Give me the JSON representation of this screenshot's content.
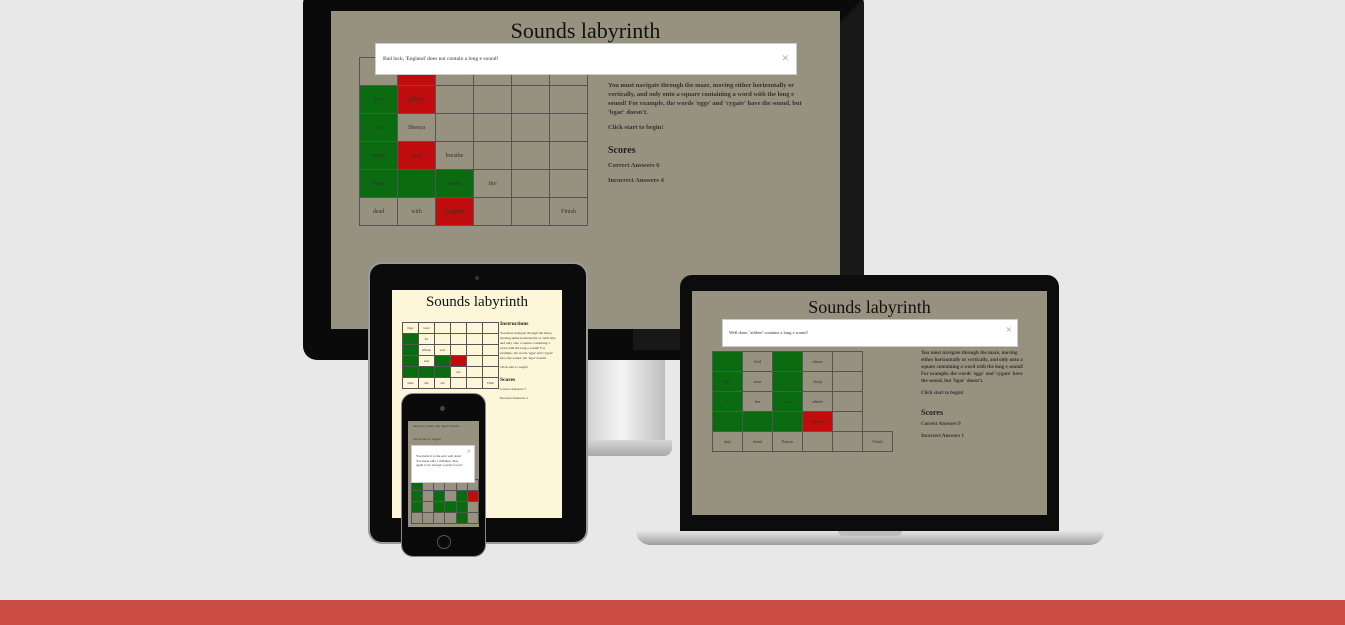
{
  "game_title": "Sounds labyrinth",
  "desktop": {
    "alert": "Bad luck, 'England' does not contain a long e sound!",
    "instructions": "You must navigate through the maze, moving either horizontally or vertically, and only onto a square containing a word with the long e sound! For example, the words 'eggs' and 'cygate' have the sound, but 'bgar' doesn't.",
    "start": "Click start to begin!",
    "scores_heading": "Scores",
    "correct": "Correct Answers 6",
    "incorrect": "Incorrect Answers 4",
    "maze": [
      [
        {
          "t": "",
          "c": ""
        },
        {
          "t": "",
          "c": "r"
        },
        {
          "t": "",
          "c": ""
        },
        {
          "t": "",
          "c": ""
        },
        {
          "t": "",
          "c": ""
        },
        {
          "t": "",
          "c": ""
        }
      ],
      [
        {
          "t": "key",
          "c": "g"
        },
        {
          "t": "pillow",
          "c": "r"
        },
        {
          "t": "",
          "c": ""
        },
        {
          "t": "",
          "c": ""
        },
        {
          "t": "",
          "c": ""
        },
        {
          "t": "",
          "c": ""
        }
      ],
      [
        {
          "t": "ice",
          "c": "g"
        },
        {
          "t": "Sheeza",
          "c": ""
        },
        {
          "t": "",
          "c": ""
        },
        {
          "t": "",
          "c": ""
        },
        {
          "t": "",
          "c": ""
        },
        {
          "t": "",
          "c": ""
        }
      ],
      [
        {
          "t": "sweep",
          "c": "g"
        },
        {
          "t": "steal",
          "c": "r"
        },
        {
          "t": "breathe",
          "c": ""
        },
        {
          "t": "",
          "c": ""
        },
        {
          "t": "",
          "c": ""
        },
        {
          "t": "",
          "c": ""
        }
      ],
      [
        {
          "t": "sheep",
          "c": "g"
        },
        {
          "t": "",
          "c": "g"
        },
        {
          "t": "seeds",
          "c": "g"
        },
        {
          "t": "fire",
          "c": ""
        },
        {
          "t": "",
          "c": ""
        },
        {
          "t": "",
          "c": ""
        }
      ],
      [
        {
          "t": "dead",
          "c": ""
        },
        {
          "t": "with",
          "c": ""
        },
        {
          "t": "England",
          "c": "r"
        },
        {
          "t": "",
          "c": ""
        },
        {
          "t": "",
          "c": ""
        },
        {
          "t": "Finish",
          "c": ""
        }
      ]
    ]
  },
  "laptop": {
    "alert": "Well done, 'athlete' contains a long e sound!",
    "instructions": "You must navigate through the maze, moving either horizontally or vertically, and only onto a square containing a word with the long e sound! For example, the words 'eggs' and 'cygate' have the sound, but 'bgar' doesn't.",
    "start": "Click start to begin!",
    "scores_heading": "Scores",
    "correct": "Correct Answers 9",
    "incorrect": "Incorrect Answers 1",
    "maze": [
      [
        {
          "t": "",
          "c": "g"
        },
        {
          "t": "field",
          "c": ""
        },
        {
          "t": "",
          "c": "g"
        },
        {
          "t": "cheese",
          "c": ""
        },
        {
          "t": "",
          "c": ""
        }
      ],
      [
        {
          "t": "seed",
          "c": "g"
        },
        {
          "t": "soon",
          "c": ""
        },
        {
          "t": "",
          "c": "g"
        },
        {
          "t": "sleep",
          "c": ""
        },
        {
          "t": "",
          "c": ""
        }
      ],
      [
        {
          "t": "tea",
          "c": "g"
        },
        {
          "t": "bee",
          "c": ""
        },
        {
          "t": "free",
          "c": "g"
        },
        {
          "t": "athlete",
          "c": ""
        },
        {
          "t": "",
          "c": ""
        }
      ],
      [
        {
          "t": "",
          "c": "g"
        },
        {
          "t": "",
          "c": "g"
        },
        {
          "t": "",
          "c": "g"
        },
        {
          "t": "athlete",
          "c": "r"
        },
        {
          "t": "",
          "c": ""
        }
      ],
      [
        {
          "t": "duty",
          "c": ""
        },
        {
          "t": "bread",
          "c": ""
        },
        {
          "t": "Pattern",
          "c": ""
        },
        {
          "t": "",
          "c": ""
        },
        {
          "t": "",
          "c": ""
        },
        {
          "t": "Finish",
          "c": ""
        }
      ]
    ]
  },
  "tablet": {
    "instructions_heading": "Instructions",
    "instructions": "You must navigate through the maze, moving either horizontally or vertically, and only onto a square containing a word with the long e sound! For example, the words 'eggs' and 'cygate' have the sound, but 'bgar' doesn't.",
    "start": "Click start to begin!",
    "scores_heading": "Scores",
    "correct": "Correct Answers 7",
    "incorrect": "Incorrect Answers 1",
    "maze": [
      [
        {
          "t": "finger",
          "c": ""
        },
        {
          "t": "bread",
          "c": ""
        },
        {
          "t": "",
          "c": ""
        },
        {
          "t": "",
          "c": ""
        },
        {
          "t": "",
          "c": ""
        },
        {
          "t": "",
          "c": ""
        }
      ],
      [
        {
          "t": "",
          "c": "g"
        },
        {
          "t": "fire",
          "c": ""
        },
        {
          "t": "",
          "c": ""
        },
        {
          "t": "",
          "c": ""
        },
        {
          "t": "",
          "c": ""
        },
        {
          "t": "",
          "c": ""
        }
      ],
      [
        {
          "t": "",
          "c": "g"
        },
        {
          "t": "different",
          "c": ""
        },
        {
          "t": "wave",
          "c": ""
        },
        {
          "t": "",
          "c": ""
        },
        {
          "t": "",
          "c": ""
        },
        {
          "t": "",
          "c": ""
        }
      ],
      [
        {
          "t": "",
          "c": "g"
        },
        {
          "t": "dead",
          "c": ""
        },
        {
          "t": "",
          "c": "g"
        },
        {
          "t": "",
          "c": "r"
        },
        {
          "t": "",
          "c": ""
        },
        {
          "t": "",
          "c": ""
        }
      ],
      [
        {
          "t": "",
          "c": "g"
        },
        {
          "t": "",
          "c": "g"
        },
        {
          "t": "",
          "c": "g"
        },
        {
          "t": "dew",
          "c": ""
        },
        {
          "t": "",
          "c": ""
        },
        {
          "t": "",
          "c": ""
        }
      ],
      [
        {
          "t": "where",
          "c": ""
        },
        {
          "t": "ship",
          "c": ""
        },
        {
          "t": "verb",
          "c": ""
        },
        {
          "t": "",
          "c": ""
        },
        {
          "t": "",
          "c": ""
        },
        {
          "t": "Finish",
          "c": ""
        }
      ]
    ]
  },
  "phone": {
    "top_text": "have the sound, but 'bgar' doesn't.",
    "start": "Click start to begin!",
    "alert": "You made it to the end, well done! You made only 1 mistakes. Play again to try and get a perfect score!"
  }
}
